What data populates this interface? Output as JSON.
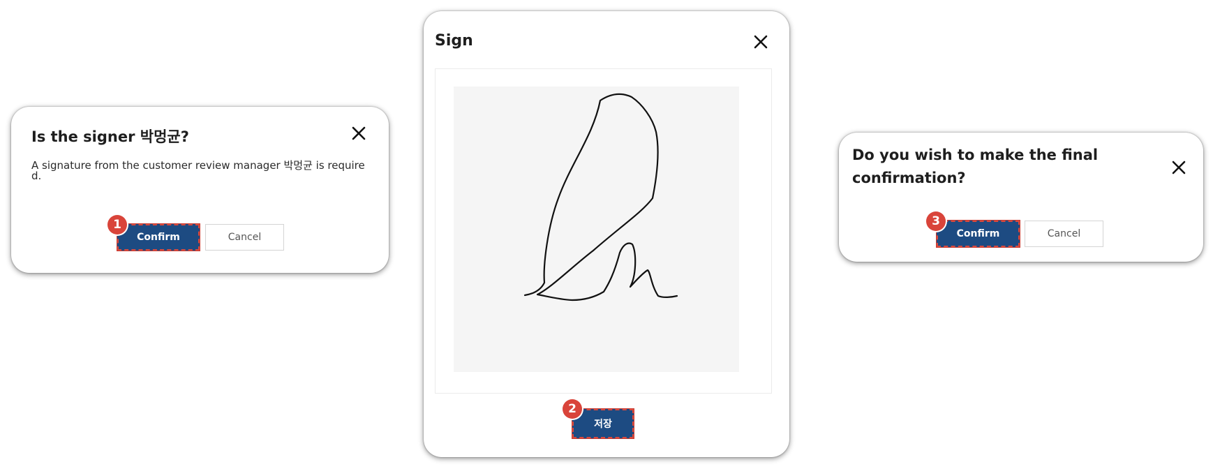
{
  "dialog_signer": {
    "title": "Is the signer 박멍균?",
    "message": "A signature from the customer review manager 박멍균 is required.",
    "confirm_label": "Confirm",
    "cancel_label": "Cancel",
    "step": "1",
    "close_icon": "close-icon"
  },
  "dialog_sign": {
    "title": "Sign",
    "save_label": "저장",
    "step": "2",
    "close_icon": "close-icon"
  },
  "dialog_final": {
    "title": "Do you wish to make the final confirmation?",
    "confirm_label": "Confirm",
    "cancel_label": "Cancel",
    "step": "3",
    "close_icon": "close-icon"
  },
  "colors": {
    "primary_button": "#1d4b82",
    "step_badge": "#d9443a",
    "highlight_dash": "#d84a3e"
  }
}
